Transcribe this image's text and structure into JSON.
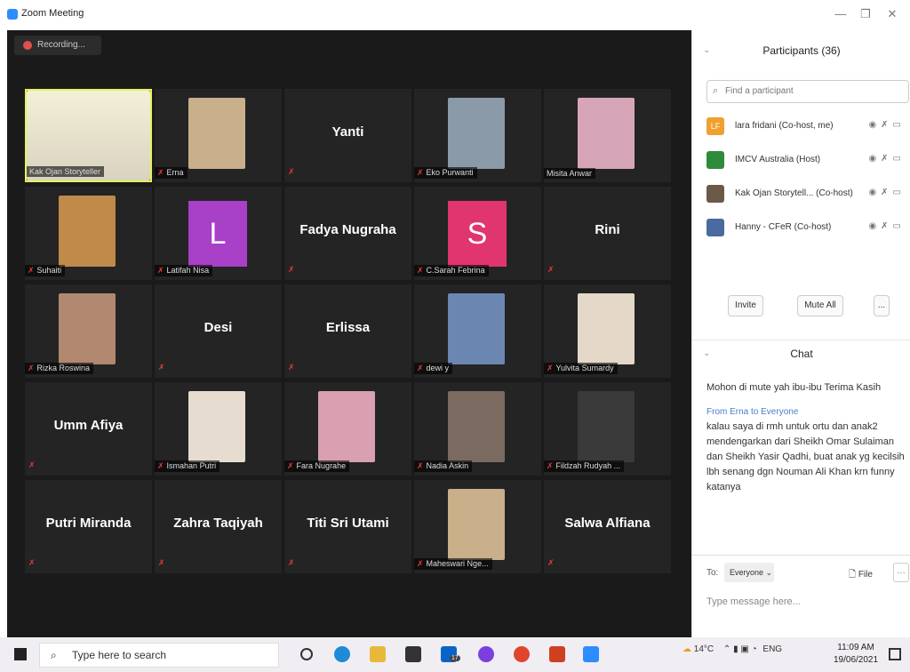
{
  "window": {
    "title": "Zoom Meeting",
    "minimize": "—",
    "maximize": "❐",
    "close": "✕"
  },
  "recording": {
    "label": "Recording..."
  },
  "tiles": [
    {
      "name": "Kak Ojan Storyteller",
      "label": "Kak Ojan Storyteller",
      "show_name": false,
      "muted": false,
      "kind": "photo"
    },
    {
      "name": "Erna",
      "label": "Erna",
      "show_name": false,
      "muted": true,
      "kind": "photo"
    },
    {
      "name": "Yanti",
      "label": "",
      "show_name": true,
      "muted": true,
      "kind": "name"
    },
    {
      "name": "Eko Purwanti",
      "label": "Eko Purwanti",
      "show_name": false,
      "muted": true,
      "kind": "photo"
    },
    {
      "name": "Misita Anwar",
      "label": "Misita Anwar",
      "show_name": false,
      "muted": false,
      "kind": "photo"
    },
    {
      "name": "Suhaiti",
      "label": "Suhaiti",
      "show_name": false,
      "muted": true,
      "kind": "photo"
    },
    {
      "name": "Latifah Nisa",
      "label": "Latifah Nisa",
      "show_name": false,
      "muted": true,
      "kind": "avatar",
      "letter": "L",
      "color": "#a840c8"
    },
    {
      "name": "Fadya Nugraha",
      "label": "",
      "show_name": true,
      "muted": true,
      "kind": "name"
    },
    {
      "name": "C.Sarah Febrina",
      "label": "C.Sarah Febrina",
      "show_name": false,
      "muted": true,
      "kind": "avatar",
      "letter": "S",
      "color": "#e0356e"
    },
    {
      "name": "Rini",
      "label": "",
      "show_name": true,
      "muted": true,
      "kind": "name"
    },
    {
      "name": "Rizka Roswina",
      "label": "Rizka Roswina",
      "show_name": false,
      "muted": true,
      "kind": "photo"
    },
    {
      "name": "Desi",
      "label": "",
      "show_name": true,
      "muted": true,
      "kind": "name"
    },
    {
      "name": "Erlissa",
      "label": "",
      "show_name": true,
      "muted": true,
      "kind": "name"
    },
    {
      "name": "dewi y",
      "label": "dewi y",
      "show_name": false,
      "muted": true,
      "kind": "photo"
    },
    {
      "name": "Yulvita Sumardy",
      "label": "Yulvita Sumardy",
      "show_name": false,
      "muted": true,
      "kind": "photo"
    },
    {
      "name": "Umm Afiya",
      "label": "",
      "show_name": true,
      "muted": true,
      "kind": "name"
    },
    {
      "name": "Ismahan Putri",
      "label": "Ismahan Putri",
      "show_name": false,
      "muted": true,
      "kind": "photo"
    },
    {
      "name": "Fara Nugrahe",
      "label": "Fara Nugrahe",
      "show_name": false,
      "muted": true,
      "kind": "photo"
    },
    {
      "name": "Nadia Askin",
      "label": "Nadia Askin",
      "show_name": false,
      "muted": true,
      "kind": "photo"
    },
    {
      "name": "Fildzah Rudyah",
      "label": "Fildzah Rudyah ...",
      "show_name": false,
      "muted": true,
      "kind": "photo"
    },
    {
      "name": "Putri Miranda",
      "label": "",
      "show_name": true,
      "muted": true,
      "kind": "name"
    },
    {
      "name": "Zahra Taqiyah",
      "label": "",
      "show_name": true,
      "muted": true,
      "kind": "name"
    },
    {
      "name": "Titi Sri Utami",
      "label": "",
      "show_name": true,
      "muted": true,
      "kind": "name"
    },
    {
      "name": "Maheswari Nge",
      "label": "Maheswari Nge...",
      "show_name": false,
      "muted": true,
      "kind": "photo"
    },
    {
      "name": "Salwa Alfiana",
      "label": "",
      "show_name": true,
      "muted": true,
      "kind": "name"
    }
  ],
  "participants": {
    "title": "Participants (36)",
    "search_placeholder": "Find a participant",
    "list": [
      {
        "name": "lara fridani (Co-host, me)",
        "initials": "LF",
        "color": "#f0a030"
      },
      {
        "name": "IMCV Australia (Host)",
        "initials": "",
        "color": "#2f8a3a"
      },
      {
        "name": "Kak Ojan Storytell... (Co-host)",
        "initials": "",
        "color": "#6b5a48"
      },
      {
        "name": "Hanny - CFeR (Co-host)",
        "initials": "",
        "color": "#4a6aa0"
      }
    ],
    "invite": "Invite",
    "mute_all": "Mute All",
    "more": "..."
  },
  "chat": {
    "title": "Chat",
    "messages": [
      {
        "from": "",
        "text": "Mohon di mute yah ibu-ibu Terima Kasih"
      },
      {
        "from": "From Erna to Everyone",
        "text": "kalau saya di rmh untuk ortu dan anak2 mendengarkan dari Sheikh Omar Sulaiman dan Sheikh Yasir Qadhi, buat anak yg kecilsih lbh senang dgn Nouman Ali Khan krn funny katanya"
      }
    ],
    "to_label": "To:",
    "to_value": "Everyone",
    "file_label": "File",
    "placeholder": "Type message here..."
  },
  "taskbar": {
    "search": "Type here to search",
    "weather": "14°C",
    "lang": "ENG",
    "time": "11:09 AM",
    "date": "19/06/2021",
    "notif_badge": "17"
  }
}
